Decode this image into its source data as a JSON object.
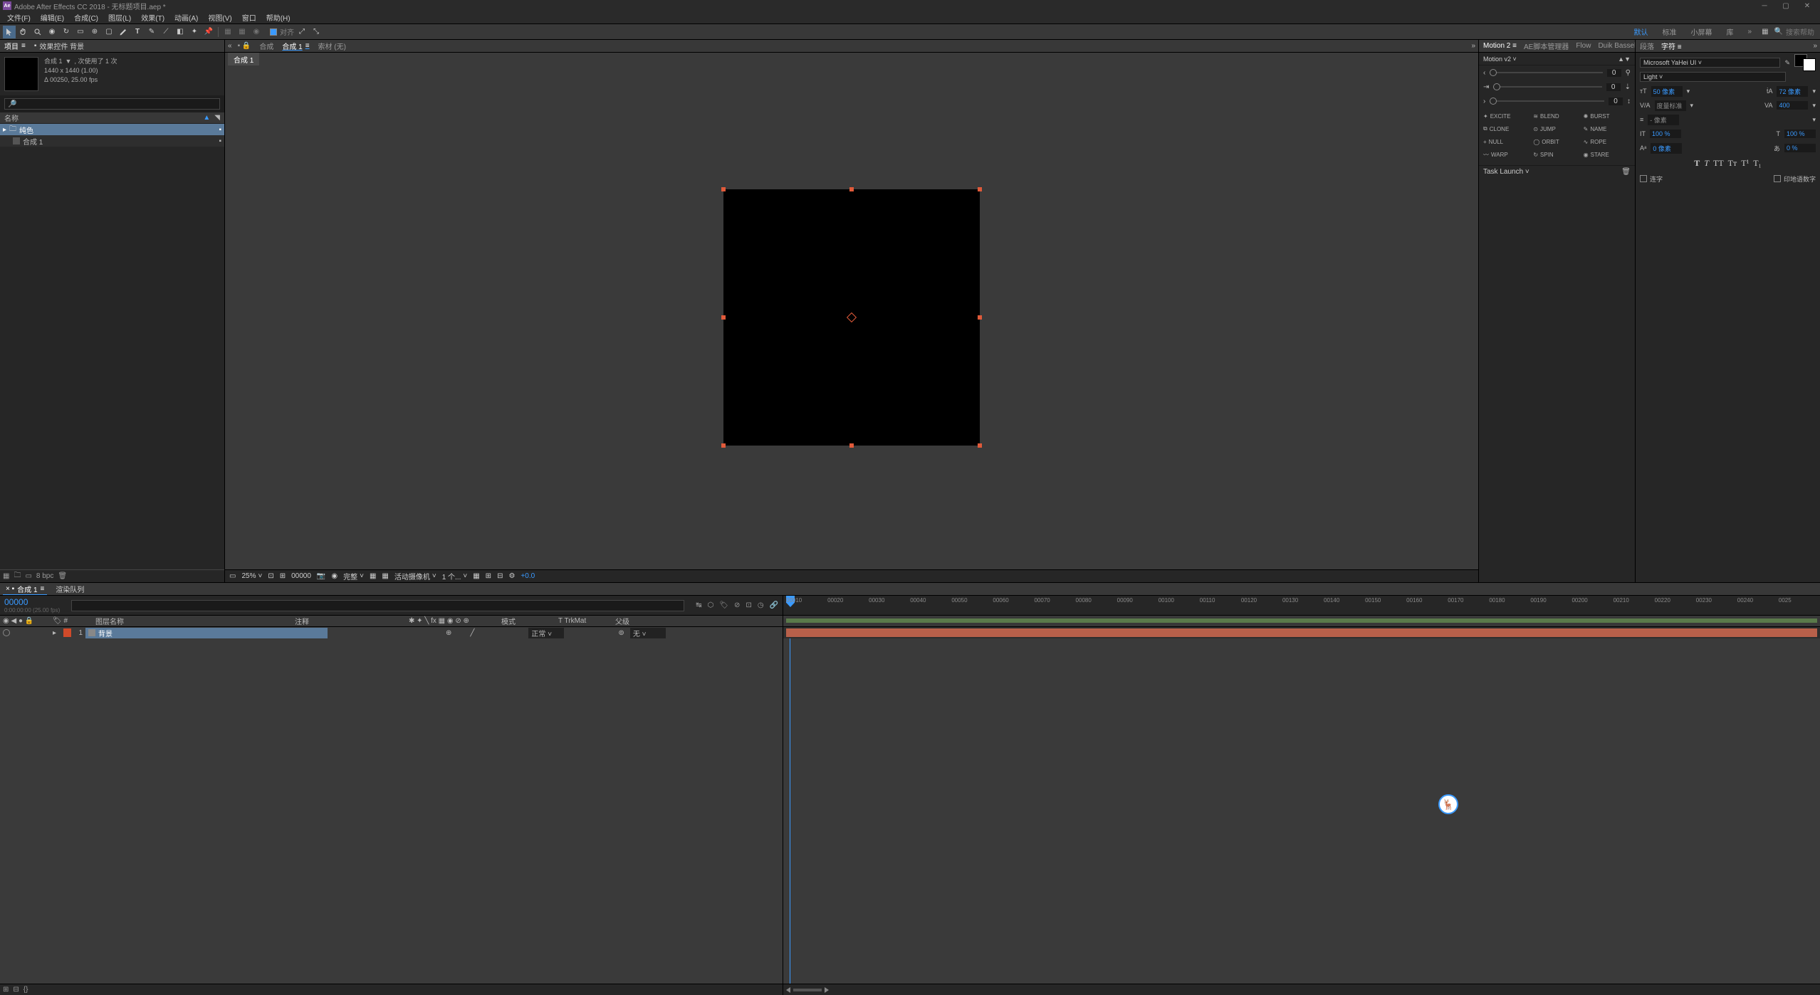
{
  "title": "Adobe After Effects CC 2018 - 无标题项目.aep *",
  "menu": [
    "文件(F)",
    "编辑(E)",
    "合成(C)",
    "图层(L)",
    "效果(T)",
    "动画(A)",
    "视图(V)",
    "窗口",
    "帮助(H)"
  ],
  "toolbar": {
    "snap": "对齐"
  },
  "workspace": {
    "active": "默认",
    "others": [
      "标准",
      "小屏幕",
      "库"
    ],
    "search_ph": "搜索帮助"
  },
  "project": {
    "tab": "项目",
    "fx_tab": "效果控件 背景",
    "comp_name": "合成 1",
    "uses": "1",
    "dims": "1440 x 1440 (1.00)",
    "fps": "Δ 00250, 25.00 fps",
    "col_name": "名称",
    "folder": "纯色",
    "comp_item": "合成 1",
    "bpc": "8 bpc"
  },
  "viewer": {
    "tab_label_a": "合成",
    "tab_active": "合成 1",
    "tab_fx": "索材 (无)",
    "subtab": "合成 1",
    "zoom": "25%",
    "frame": "00000",
    "res": "完整",
    "camera": "活动摄像机",
    "views": "1 个...",
    "exp": "+0.0"
  },
  "motion": {
    "tabs": [
      "Motion 2",
      "AE脚本管理器",
      "Flow",
      "Duik Bassel"
    ],
    "dd": "Motion v2",
    "sliders": [
      0,
      0,
      0
    ],
    "btns": [
      [
        "EXCITE",
        "BLEND",
        "BURST"
      ],
      [
        "CLONE",
        "JUMP",
        "NAME"
      ],
      [
        "NULL",
        "ORBIT",
        "ROPE"
      ],
      [
        "WARP",
        "SPIN",
        "STARE"
      ]
    ],
    "task": "Task Launch"
  },
  "char": {
    "tabs": [
      "段落",
      "字符"
    ],
    "font": "Microsoft YaHei UI",
    "weight": "Light",
    "size": "50 像素",
    "leading": "72 像素",
    "kerning": "度量标准",
    "tracking": "400",
    "hscale": "100 %",
    "vscale": "100 %",
    "baseline": "0 像素",
    "tsume": "0 %",
    "chk1": "连字",
    "chk2": "印地语数字"
  },
  "timeline": {
    "tab": "合成 1",
    "render_tab": "渲染队列",
    "timecode": "00000",
    "subtc": "0:00:00:00 (25.00 fps)",
    "cols": {
      "name": "图层名称",
      "comment": "注释",
      "mode": "模式",
      "trk": "T TrkMat",
      "parent": "父级"
    },
    "layer": {
      "num": "1",
      "name": "背景",
      "mode": "正常",
      "parent": "无"
    },
    "ticks": [
      "00010",
      "00020",
      "00030",
      "00040",
      "00050",
      "00060",
      "00070",
      "00080",
      "00090",
      "00100",
      "00110",
      "00120",
      "00130",
      "00140",
      "00150",
      "00160",
      "00170",
      "00180",
      "00190",
      "00200",
      "00210",
      "00220",
      "00230",
      "00240",
      "0025"
    ]
  }
}
